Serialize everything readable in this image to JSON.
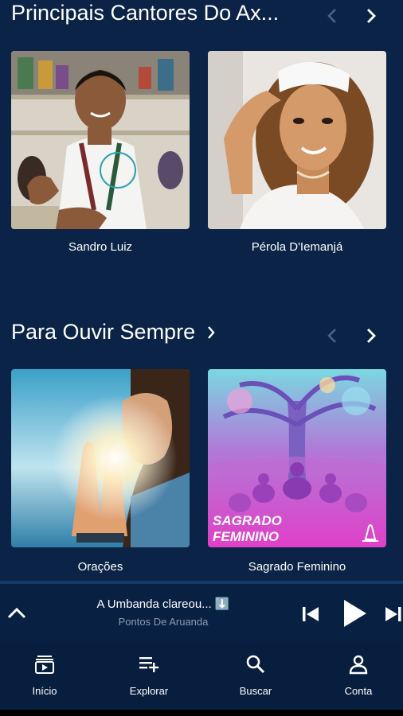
{
  "sections": [
    {
      "title": "Principais Cantores Do Ax...",
      "cards": [
        {
          "label": "Sandro Luiz"
        },
        {
          "label": "Pérola D'Iemanjá"
        }
      ]
    },
    {
      "title": "Para Ouvir Sempre",
      "cards": [
        {
          "label": "Orações"
        },
        {
          "label": "Sagrado Feminino",
          "art_text_1": "SAGRADO",
          "art_text_2": "FEMININO"
        }
      ]
    }
  ],
  "player": {
    "track_title": "A Umbanda clareou... ⬇️",
    "track_artist": "Pontos De Aruanda"
  },
  "nav": [
    {
      "label": "Início",
      "icon": "home-icon"
    },
    {
      "label": "Explorar",
      "icon": "playlist-add-icon"
    },
    {
      "label": "Buscar",
      "icon": "search-icon"
    },
    {
      "label": "Conta",
      "icon": "account-icon"
    }
  ],
  "colors": {
    "background": "#0a2346",
    "player_bg": "#082042",
    "nav_bg": "#081e3e"
  }
}
